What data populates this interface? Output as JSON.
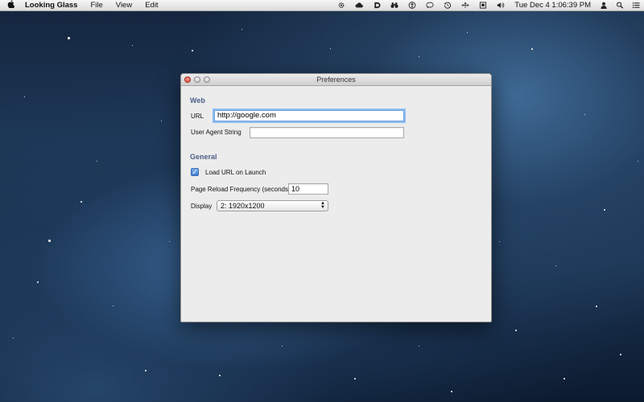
{
  "menubar": {
    "app_name": "Looking Glass",
    "menus": [
      "File",
      "View",
      "Edit"
    ],
    "clock": "Tue Dec 4  1:06:39 PM",
    "status_icons": [
      "gear-icon",
      "cloud-icon",
      "dashlane-icon",
      "binoculars-icon",
      "accessibility-icon",
      "message-icon",
      "time-machine-icon",
      "network-icon",
      "display-icon",
      "volume-icon"
    ]
  },
  "window": {
    "title": "Preferences",
    "web": {
      "heading": "Web",
      "url_label": "URL",
      "url_value": "http://google.com",
      "user_agent_label": "User Agent String",
      "user_agent_value": ""
    },
    "general": {
      "heading": "General",
      "load_url_label": "Load URL on Launch",
      "load_url_checked": true,
      "reload_label": "Page Reload Frequency (seconds)",
      "reload_value": "10",
      "display_label": "Display",
      "display_value": "2: 1920x1200"
    }
  }
}
